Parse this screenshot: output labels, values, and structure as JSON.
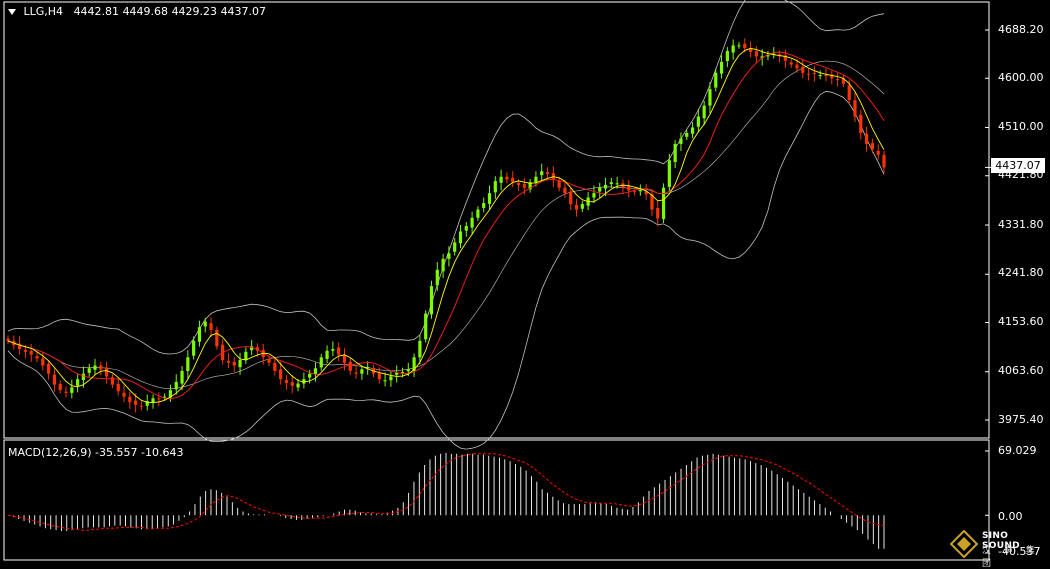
{
  "header": {
    "symbol": "LLG,H4",
    "open": "4442.81",
    "high": "4449.68",
    "low": "4429.23",
    "close": "4437.07"
  },
  "last_price": "4437.07",
  "macd_header": {
    "label": "MACD(12,26,9)",
    "macd": "-35.557",
    "signal": "-10.643"
  },
  "watermark": {
    "name": "SINO SOUND",
    "chinese": "汉 声 集 团"
  },
  "colors": {
    "background": "#000000",
    "bull_candle": "#7cfc00",
    "bear_candle": "#ff3300",
    "fast_ma": "#ffff00",
    "slow_ma": "#ff2020",
    "bollinger": "#c0c0c0",
    "macd_hist": "#ffffff",
    "macd_signal": "#ff0000",
    "frame": "#ffffff"
  },
  "chart_data": [
    {
      "type": "candlestick",
      "title": "LLG,H4",
      "y_ticks": [
        "4688.20",
        "4600.00",
        "4510.00",
        "4421.80",
        "4331.80",
        "4241.80",
        "4153.60",
        "4063.60",
        "3975.40"
      ],
      "y_tick_values": [
        4688.2,
        4600.0,
        4510.0,
        4421.8,
        4331.8,
        4241.8,
        4153.6,
        4063.6,
        3975.4
      ],
      "ylim": [
        3950,
        4730
      ],
      "overlays": [
        "fast MA (yellow)",
        "slow MA (red)",
        "Bollinger Bands (gray)"
      ],
      "close": [
        4120,
        4112,
        4105,
        4100,
        4095,
        4088,
        4075,
        4060,
        4040,
        4030,
        4025,
        4035,
        4050,
        4060,
        4070,
        4075,
        4068,
        4055,
        4040,
        4028,
        4018,
        4008,
        4003,
        4000,
        4010,
        4015,
        4014,
        4018,
        4030,
        4045,
        4065,
        4090,
        4120,
        4145,
        4155,
        4140,
        4110,
        4085,
        4080,
        4075,
        4085,
        4100,
        4110,
        4102,
        4090,
        4080,
        4065,
        4050,
        4043,
        4038,
        4042,
        4050,
        4060,
        4070,
        4090,
        4102,
        4105,
        4095,
        4080,
        4065,
        4060,
        4068,
        4072,
        4060,
        4050,
        4048,
        4055,
        4062,
        4063,
        4068,
        4090,
        4120,
        4170,
        4220,
        4250,
        4270,
        4280,
        4300,
        4320,
        4330,
        4345,
        4360,
        4372,
        4390,
        4412,
        4420,
        4415,
        4410,
        4405,
        4400,
        4410,
        4420,
        4430,
        4425,
        4415,
        4400,
        4390,
        4370,
        4360,
        4370,
        4382,
        4390,
        4400,
        4405,
        4410,
        4408,
        4400,
        4395,
        4392,
        4396,
        4388,
        4360,
        4344,
        4400,
        4450,
        4480,
        4490,
        4500,
        4510,
        4530,
        4550,
        4580,
        4610,
        4630,
        4650,
        4660,
        4660,
        4655,
        4648,
        4640,
        4640,
        4642,
        4645,
        4640,
        4632,
        4625,
        4618,
        4610,
        4608,
        4608,
        4606,
        4604,
        4600,
        4598,
        4590,
        4560,
        4530,
        4500,
        4480,
        4470,
        4460,
        4437
      ],
      "x_range": [
        0,
        168
      ]
    },
    {
      "type": "macd",
      "title": "MACD(12,26,9)",
      "macd_value": -35.557,
      "signal_value": -10.643,
      "y_ticks": [
        "69.029",
        "0.00",
        "-40.537"
      ],
      "y_tick_values": [
        69.029,
        0.0,
        -40.537
      ],
      "ylim": [
        -40.537,
        69.029
      ],
      "histogram": [
        0,
        -2,
        -4,
        -6,
        -8,
        -10,
        -12,
        -14,
        -15,
        -16,
        -17,
        -17,
        -16,
        -15,
        -14,
        -13,
        -13,
        -13,
        -13,
        -12,
        -11,
        -11,
        -12,
        -13,
        -14,
        -15,
        -15,
        -15,
        -14,
        -13,
        -12,
        -10,
        -6,
        -2,
        4,
        12,
        20,
        26,
        28,
        27,
        24,
        20,
        14,
        8,
        4,
        2,
        1,
        1,
        1,
        0,
        0,
        -1,
        -3,
        -4,
        -5,
        -5,
        -4,
        -3,
        -2,
        -1,
        0,
        2,
        4,
        6,
        6,
        5,
        3,
        2,
        2,
        1,
        1,
        3,
        5,
        8,
        14,
        24,
        36,
        46,
        54,
        60,
        64,
        66,
        67,
        66,
        66,
        65,
        66,
        66,
        65,
        65,
        64,
        63,
        62,
        60,
        58,
        55,
        52,
        48,
        42,
        36,
        28,
        24,
        20,
        16,
        13,
        12,
        12,
        12,
        12,
        13,
        14,
        13,
        12,
        10,
        8,
        7,
        6,
        9,
        14,
        20,
        26,
        30,
        34,
        38,
        42,
        46,
        50,
        54,
        58,
        62,
        64,
        65,
        66,
        65,
        64,
        63,
        62,
        61,
        60,
        58,
        56,
        54,
        51,
        48,
        44,
        40,
        36,
        32,
        28,
        24,
        20,
        16,
        12,
        8,
        4,
        0,
        -4,
        -8,
        -12,
        -16,
        -20,
        -26,
        -31,
        -36,
        -36
      ],
      "signal": [
        0,
        -1,
        -2,
        -3,
        -5,
        -6,
        -8,
        -9,
        -11,
        -12,
        -13,
        -14,
        -15,
        -15,
        -16,
        -16,
        -15,
        -15,
        -14,
        -14,
        -14,
        -13,
        -13,
        -13,
        -13,
        -13,
        -14,
        -14,
        -14,
        -14,
        -14,
        -13,
        -12,
        -10,
        -8,
        -5,
        -1,
        5,
        11,
        16,
        19,
        21,
        20,
        18,
        15,
        12,
        9,
        7,
        5,
        3,
        2,
        1,
        0,
        -1,
        -2,
        -3,
        -3,
        -3,
        -3,
        -3,
        -2,
        -1,
        0,
        1,
        2,
        2,
        3,
        3,
        3,
        2,
        2,
        2,
        2,
        4,
        6,
        9,
        15,
        22,
        30,
        37,
        44,
        50,
        55,
        59,
        62,
        64,
        65,
        66,
        66,
        66,
        66,
        66,
        65,
        64,
        62,
        60,
        58,
        56,
        52,
        48,
        43,
        38,
        33,
        29,
        25,
        21,
        18,
        16,
        14,
        14,
        13,
        13,
        13,
        13,
        12,
        11,
        10,
        10,
        11,
        13,
        16,
        19,
        22,
        26,
        30,
        34,
        38,
        42,
        46,
        50,
        54,
        57,
        60,
        62,
        64,
        64,
        64,
        64,
        63,
        62,
        61,
        60,
        58,
        56,
        54,
        51,
        48,
        45,
        42,
        38,
        35,
        31,
        27,
        23,
        19,
        15,
        11,
        7,
        3,
        -1,
        -4,
        -7,
        -9,
        -10,
        -11
      ],
      "x_range": [
        0,
        168
      ]
    }
  ]
}
